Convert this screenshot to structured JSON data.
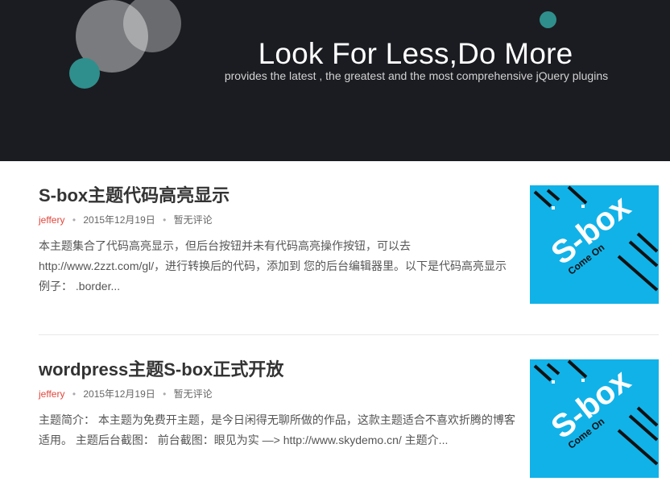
{
  "hero": {
    "title": "Look For Less,Do More",
    "subtitle": "provides the latest , the greatest and the most comprehensive jQuery plugins"
  },
  "posts": [
    {
      "title": "S-box主题代码高亮显示",
      "author": "jeffery",
      "date": "2015年12月19日",
      "comments": "暂无评论",
      "excerpt": "本主题集合了代码高亮显示，但后台按钮并未有代码高亮操作按钮，可以去http://www.2zzt.com/gl/，进行转换后的代码，添加到 您的后台编辑器里。以下是代码高亮显示例子： .border...",
      "thumb_logo": "S-box",
      "thumb_tagline": "Come On"
    },
    {
      "title": "wordpress主题S-box正式开放",
      "author": "jeffery",
      "date": "2015年12月19日",
      "comments": "暂无评论",
      "excerpt": "主题简介： 本主题为免费开主题，是今日闲得无聊所做的作品，这款主题适合不喜欢折腾的博客适用。 主题后台截图： 前台截图：眼见为实 —> http://www.skydemo.cn/ 主题介...",
      "thumb_logo": "S-box",
      "thumb_tagline": "Come On"
    }
  ],
  "colors": {
    "hero_bg": "#1b1c21",
    "accent_teal": "#2f8f8c",
    "author_red": "#e2463c",
    "thumb_blue": "#11b2e8"
  }
}
